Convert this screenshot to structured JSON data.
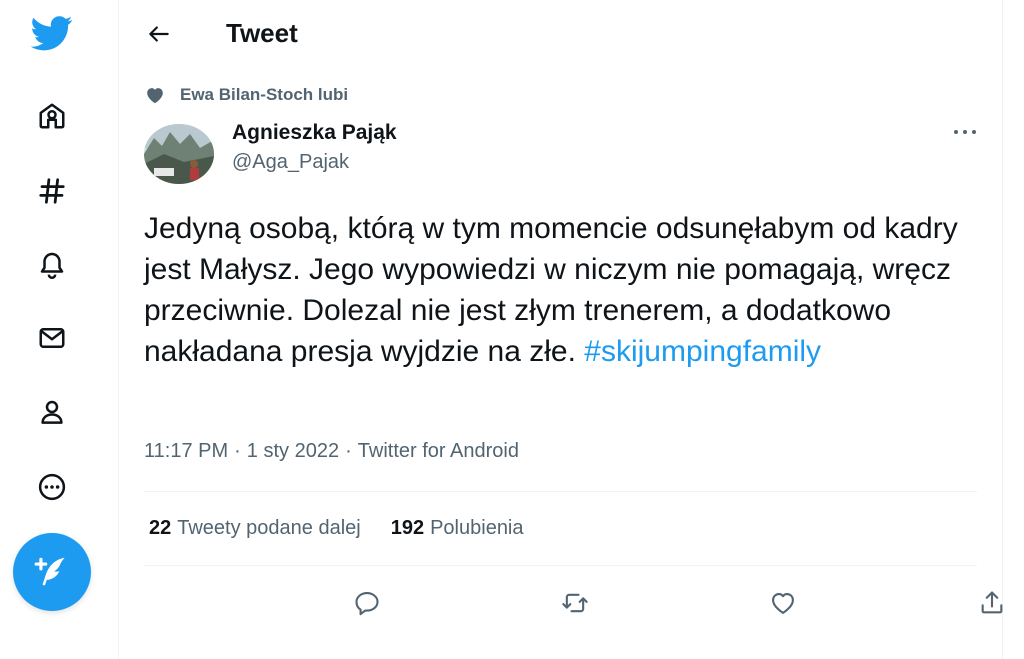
{
  "sidebar": {
    "items": [
      {
        "icon": "twitter-logo-icon",
        "color": "#1d9bf0"
      },
      {
        "icon": "home-icon"
      },
      {
        "icon": "hashtag-icon"
      },
      {
        "icon": "bell-icon"
      },
      {
        "icon": "mail-icon"
      },
      {
        "icon": "profile-icon"
      },
      {
        "icon": "more-circle-icon"
      }
    ],
    "compose": {
      "icon": "compose-feather-icon",
      "color": "#1d9bf0"
    }
  },
  "header": {
    "back_icon": "arrow-left-icon",
    "title": "Tweet"
  },
  "tweet": {
    "social_context": "Ewa Bilan-Stoch lubi",
    "author": {
      "name": "Agnieszka Pająk",
      "handle": "@Aga_Pajak"
    },
    "text": "Jedyną osobą, którą w tym momencie odsunęłabym od kadry jest Małysz. Jego wypowiedzi w niczym nie pomagają, wręcz przeciwnie. Dolezal nie jest złym trenerem, a dodatkowo nakładana presja wyjdzie na złe.",
    "hashtag": "#skijumpingfamily",
    "time": "11:17 PM",
    "date": "1 sty 2022",
    "separator": "·",
    "source": "Twitter for Android",
    "retweets": {
      "count": "22",
      "label": "Tweety podane dalej"
    },
    "likes": {
      "count": "192",
      "label": "Polubienia"
    }
  },
  "actions": [
    {
      "icon": "reply-icon"
    },
    {
      "icon": "retweet-icon"
    },
    {
      "icon": "like-heart-icon"
    },
    {
      "icon": "share-icon"
    }
  ],
  "colors": {
    "accent": "#1d9bf0",
    "text_primary": "#0f1419",
    "text_secondary": "#536471",
    "divider": "#eff3f4"
  }
}
